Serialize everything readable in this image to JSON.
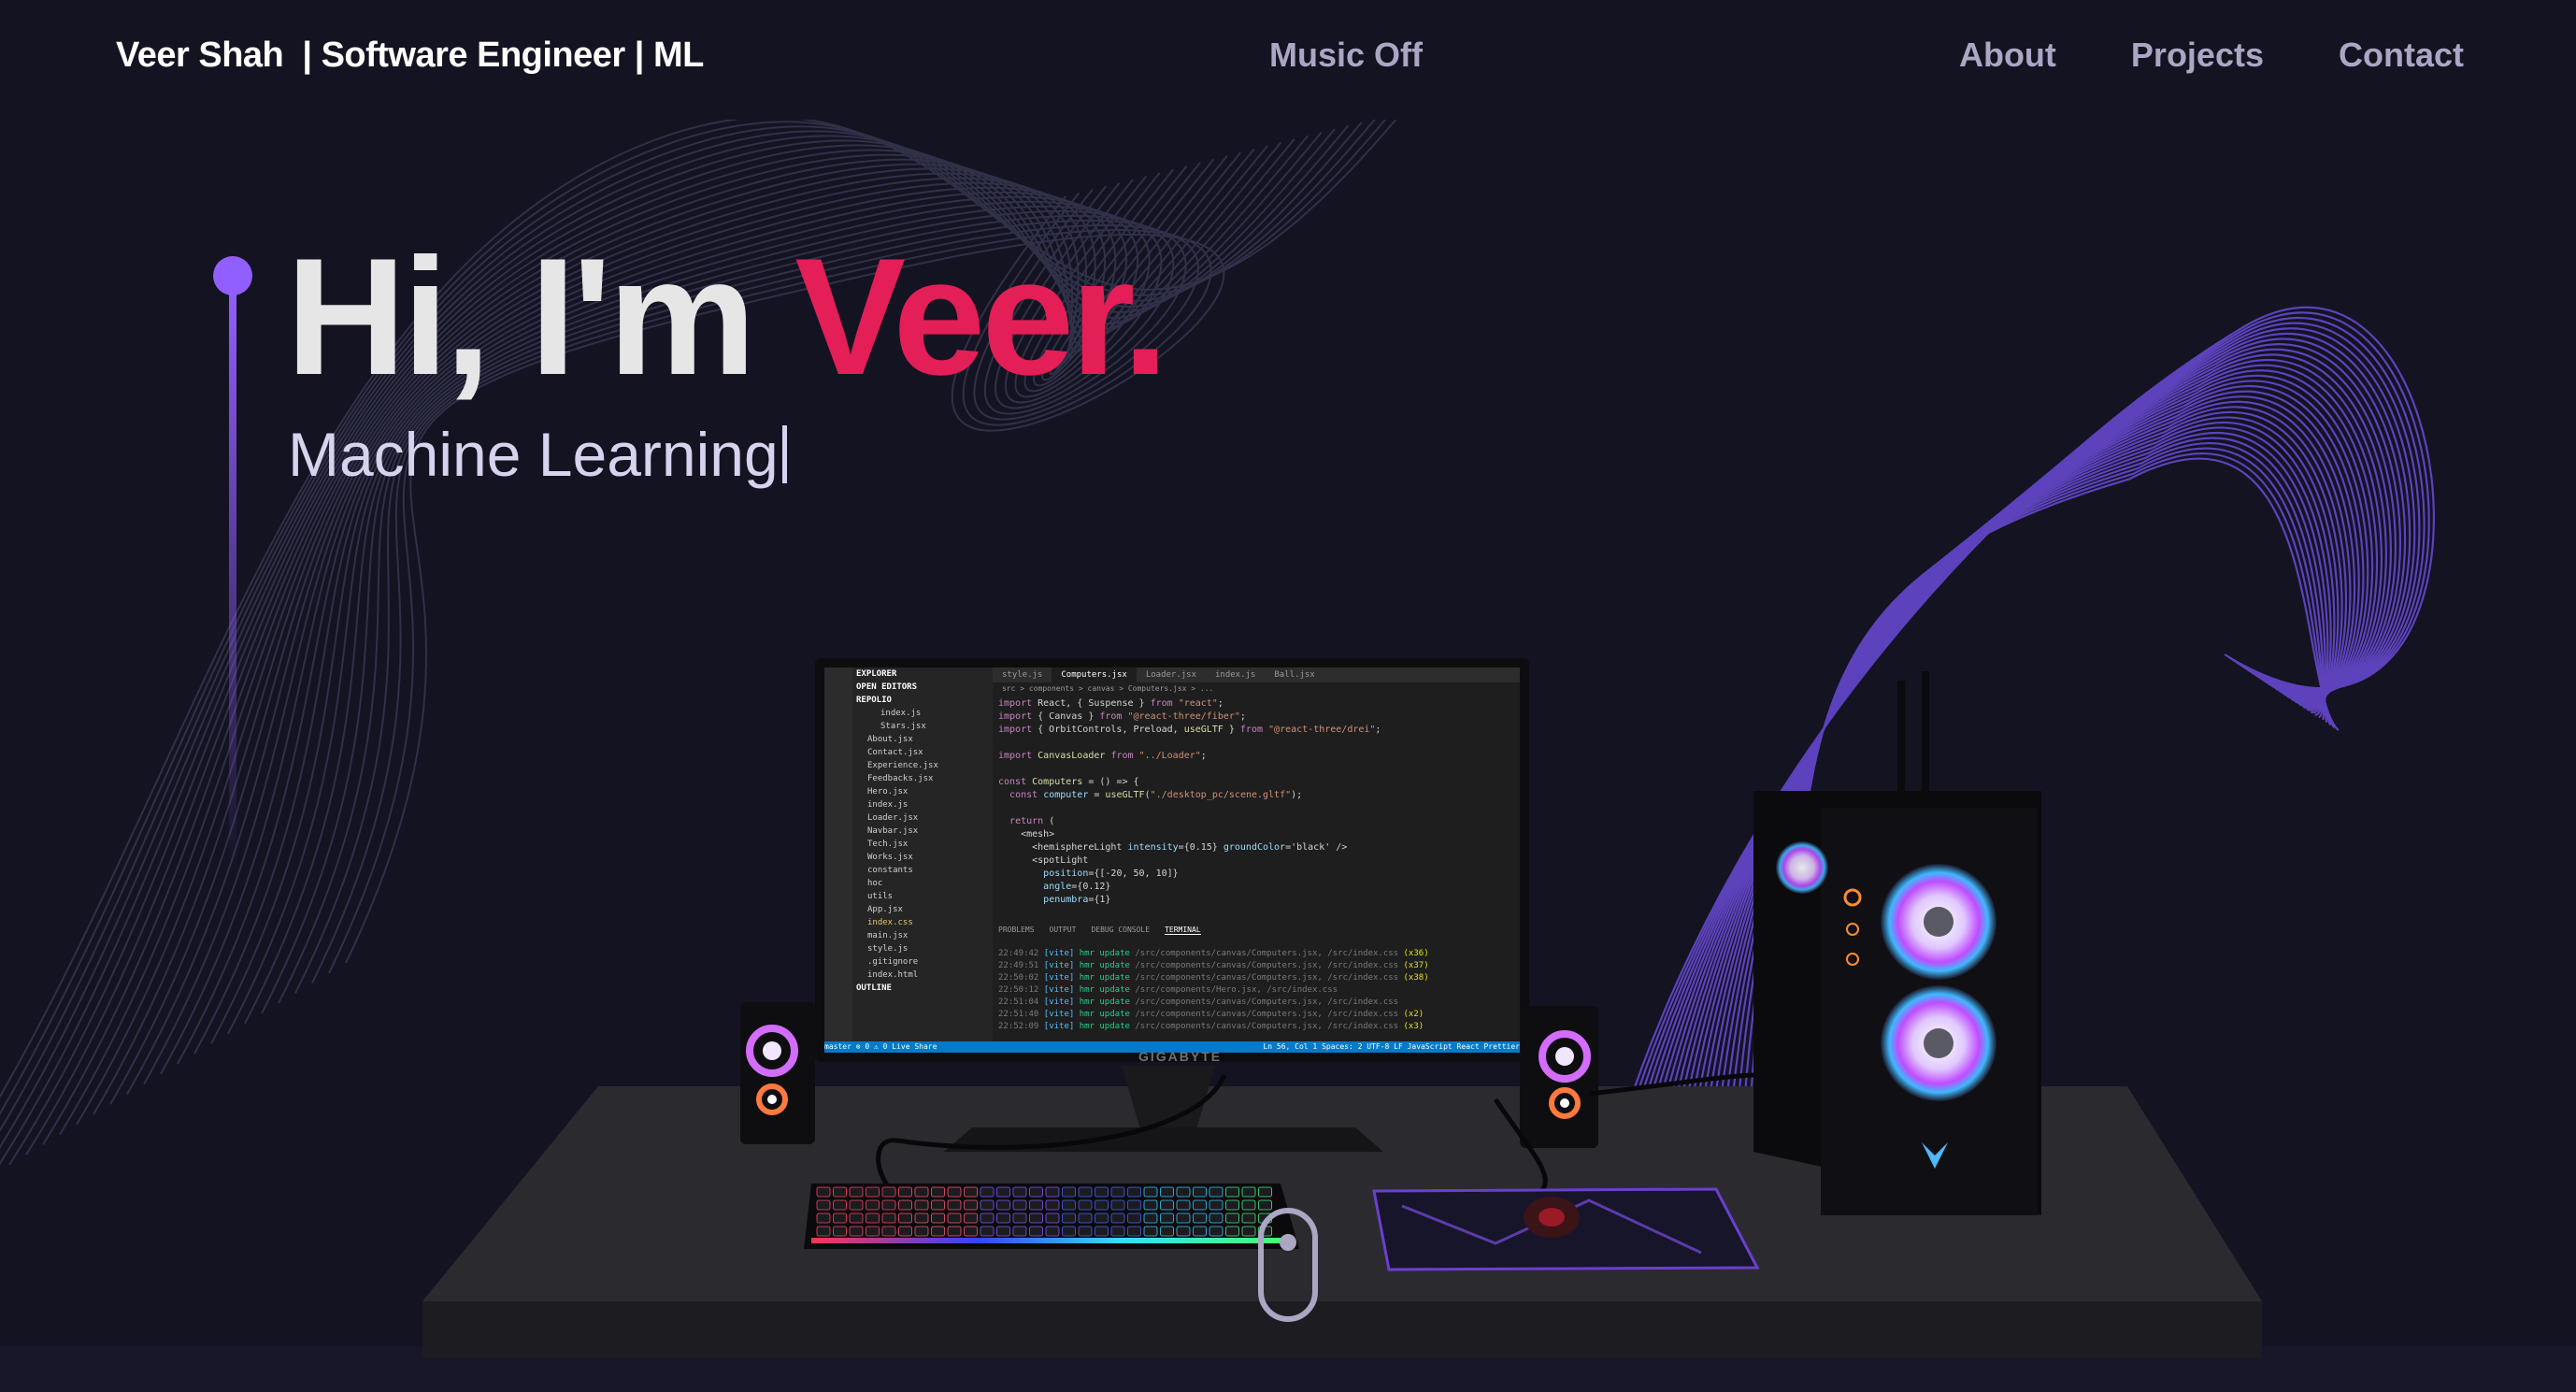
{
  "navbar": {
    "brand": "Veer Shah  | Software Engineer | ML",
    "music_toggle": "Music Off",
    "links": [
      "About",
      "Projects",
      "Contact"
    ]
  },
  "hero": {
    "greeting": "Hi, I'm ",
    "name": "Veer.",
    "role": "Machine Learning"
  },
  "colors": {
    "background": "#141322",
    "accent": "#915eff",
    "name_highlight": "#e41e57",
    "nav_text": "#aaa6c3"
  },
  "monitor": {
    "brand": "GIGABYTE",
    "editor": {
      "tabs": [
        "style.js",
        "Computers.jsx",
        "Loader.jsx",
        "index.js",
        "Ball.jsx"
      ],
      "active_tab": "Computers.jsx",
      "breadcrumbs": "src > components > canvas > Computers.jsx > ...",
      "explorer_title": "EXPLORER",
      "explorer": [
        {
          "label": "OPEN EDITORS",
          "level": "head"
        },
        {
          "label": "REPOLIO",
          "level": "head"
        },
        {
          "label": "index.js",
          "level": "sub"
        },
        {
          "label": "Stars.jsx",
          "level": "sub"
        },
        {
          "label": "About.jsx",
          "level": "item"
        },
        {
          "label": "Contact.jsx",
          "level": "item"
        },
        {
          "label": "Experience.jsx",
          "level": "item"
        },
        {
          "label": "Feedbacks.jsx",
          "level": "item"
        },
        {
          "label": "Hero.jsx",
          "level": "item"
        },
        {
          "label": "index.js",
          "level": "item"
        },
        {
          "label": "Loader.jsx",
          "level": "item"
        },
        {
          "label": "Navbar.jsx",
          "level": "item"
        },
        {
          "label": "Tech.jsx",
          "level": "item"
        },
        {
          "label": "Works.jsx",
          "level": "item"
        },
        {
          "label": "constants",
          "level": "item"
        },
        {
          "label": "hoc",
          "level": "item"
        },
        {
          "label": "utils",
          "level": "item"
        },
        {
          "label": "App.jsx",
          "level": "item"
        },
        {
          "label": "index.css",
          "level": "sel"
        },
        {
          "label": "main.jsx",
          "level": "item"
        },
        {
          "label": "style.js",
          "level": "item"
        },
        {
          "label": ".gitignore",
          "level": "item"
        },
        {
          "label": "index.html",
          "level": "item"
        },
        {
          "label": "OUTLINE",
          "level": "head"
        }
      ],
      "code": [
        "import React, { Suspense } from \"react\";",
        "import { Canvas } from \"@react-three/fiber\";",
        "import { OrbitControls, Preload, useGLTF } from \"@react-three/drei\";",
        "",
        "import CanvasLoader from \"../Loader\";",
        "",
        "const Computers = () => {",
        "  const computer = useGLTF(\"./desktop_pc/scene.gltf\");",
        "",
        "  return (",
        "    <mesh>",
        "      <hemisphereLight intensity={0.15} groundColor='black' />",
        "      <spotLight",
        "        position={[-20, 50, 10]}",
        "        angle={0.12}",
        "        penumbra={1}"
      ],
      "panel_tabs": [
        "PROBLEMS",
        "OUTPUT",
        "DEBUG CONSOLE",
        "TERMINAL"
      ],
      "active_panel": "TERMINAL",
      "terminal": [
        {
          "time": "22:49:42",
          "file": "/src/components/canvas/Computers.jsx, /src/index.css",
          "count": "(x36)"
        },
        {
          "time": "22:49:51",
          "file": "/src/components/canvas/Computers.jsx, /src/index.css",
          "count": "(x37)"
        },
        {
          "time": "22:50:02",
          "file": "/src/components/canvas/Computers.jsx, /src/index.css",
          "count": "(x38)"
        },
        {
          "time": "22:50:12",
          "file": "/src/components/Hero.jsx, /src/index.css",
          "count": ""
        },
        {
          "time": "22:51:04",
          "file": "/src/components/canvas/Computers.jsx, /src/index.css",
          "count": ""
        },
        {
          "time": "22:51:40",
          "file": "/src/components/canvas/Computers.jsx, /src/index.css",
          "count": "(x2)"
        },
        {
          "time": "22:52:09",
          "file": "/src/components/canvas/Computers.jsx, /src/index.css",
          "count": "(x3)"
        }
      ],
      "status_left": "master  ⊗ 0 ⚠ 0  Live Share",
      "status_right": "Ln 56, Col 1  Spaces: 2  UTF-8  LF  JavaScript React  Prettier"
    }
  }
}
